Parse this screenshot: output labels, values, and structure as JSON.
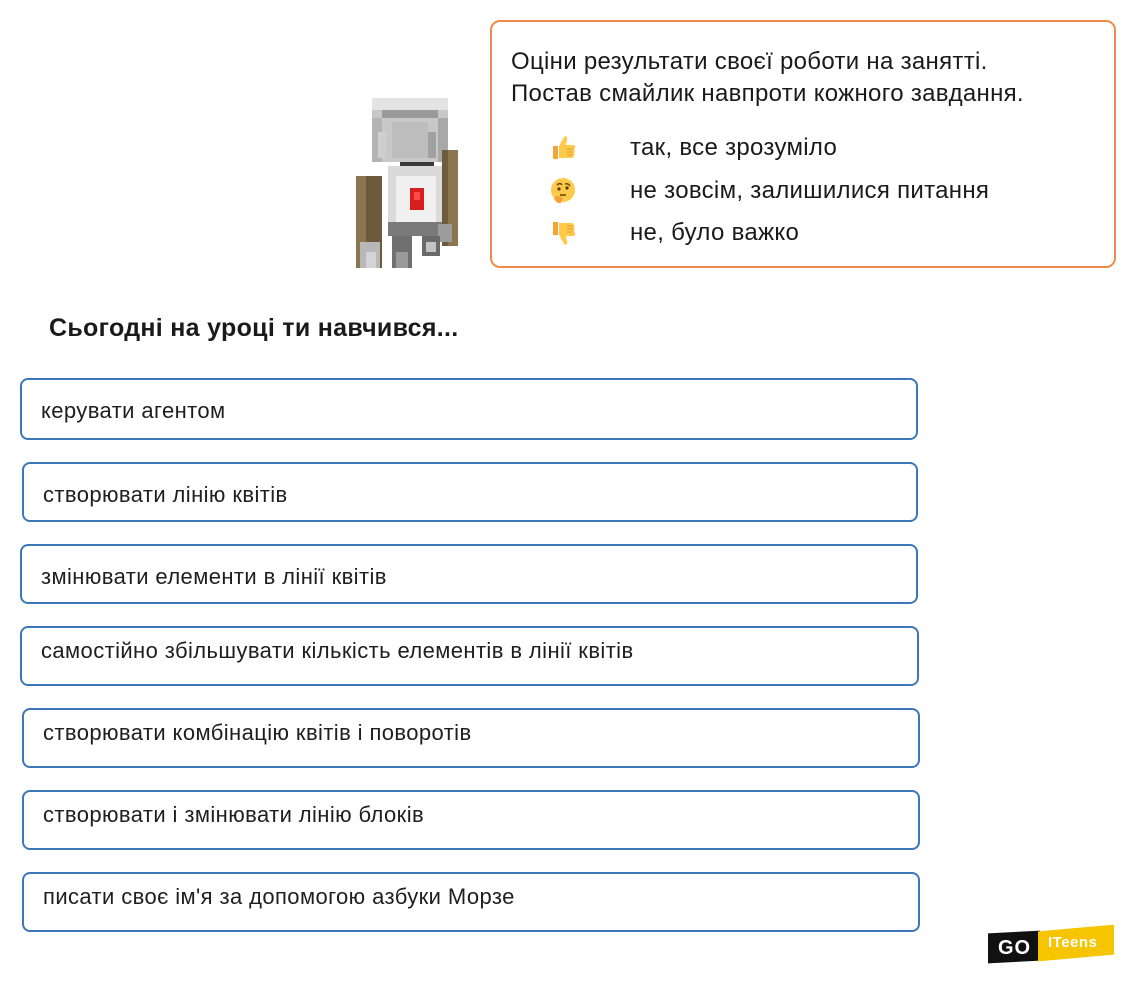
{
  "instructions": {
    "line1": "Оціни результати своєї роботи на занятті.",
    "line2": "Постав смайлик навпроти кожного завдання."
  },
  "legend": [
    {
      "icon": "thumbs-up-icon",
      "label": "так, все зрозуміло"
    },
    {
      "icon": "thinking-face-icon",
      "label": "не зовсім, залишилися питання"
    },
    {
      "icon": "thumbs-down-icon",
      "label": "не, було важко"
    }
  ],
  "title": "Сьогодні на уроці ти навчився...",
  "skills": [
    "керувати агентом",
    "створювати лінію квітів",
    "змінювати елементи в лінії квітів",
    "самостійно збільшувати кількість елементів в лінії квітів",
    "створювати комбінацію квітів і поворотів",
    "створювати і змінювати лінію блоків",
    "писати своє ім'я за допомогою азбуки Морзе"
  ],
  "logo": {
    "go": "GO",
    "teens": "ITeens"
  },
  "colors": {
    "instruction_border": "#f08a4b",
    "skill_border": "#3a78b8",
    "logo_yellow": "#f6c400",
    "logo_black": "#111111"
  }
}
